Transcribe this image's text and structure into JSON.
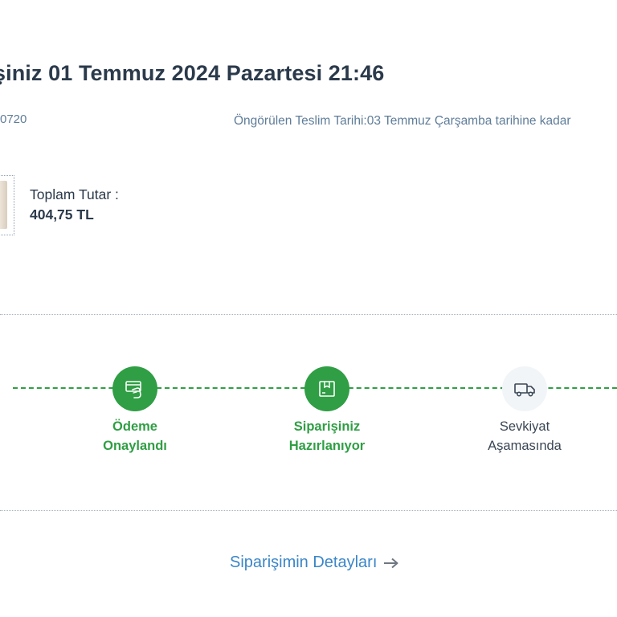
{
  "order": {
    "title": "şiniz 01 Temmuz 2024 Pazartesi 21:46",
    "order_number": "0720",
    "delivery_estimate": "Öngörülen Teslim Tarihi:03 Temmuz Çarşamba tarihine kadar"
  },
  "total": {
    "label": "Toplam Tutar :",
    "value": "404,75 TL"
  },
  "progress": {
    "steps": [
      {
        "line1": "Ödeme",
        "line2": "Onaylandı",
        "status": "done",
        "icon": "credit-card-hand-icon"
      },
      {
        "line1": "Siparişiniz",
        "line2": "Hazırlanıyor",
        "status": "done",
        "icon": "package-icon"
      },
      {
        "line1": "Sevkiyat",
        "line2": "Aşamasında",
        "status": "pending",
        "icon": "truck-icon"
      }
    ]
  },
  "details_link": {
    "label": "Siparişimin Detayları"
  },
  "colors": {
    "accent_green": "#2f9e44",
    "link_blue": "#3b86c8",
    "text_dark": "#2b3a4b",
    "text_muted": "#5f7d99"
  }
}
